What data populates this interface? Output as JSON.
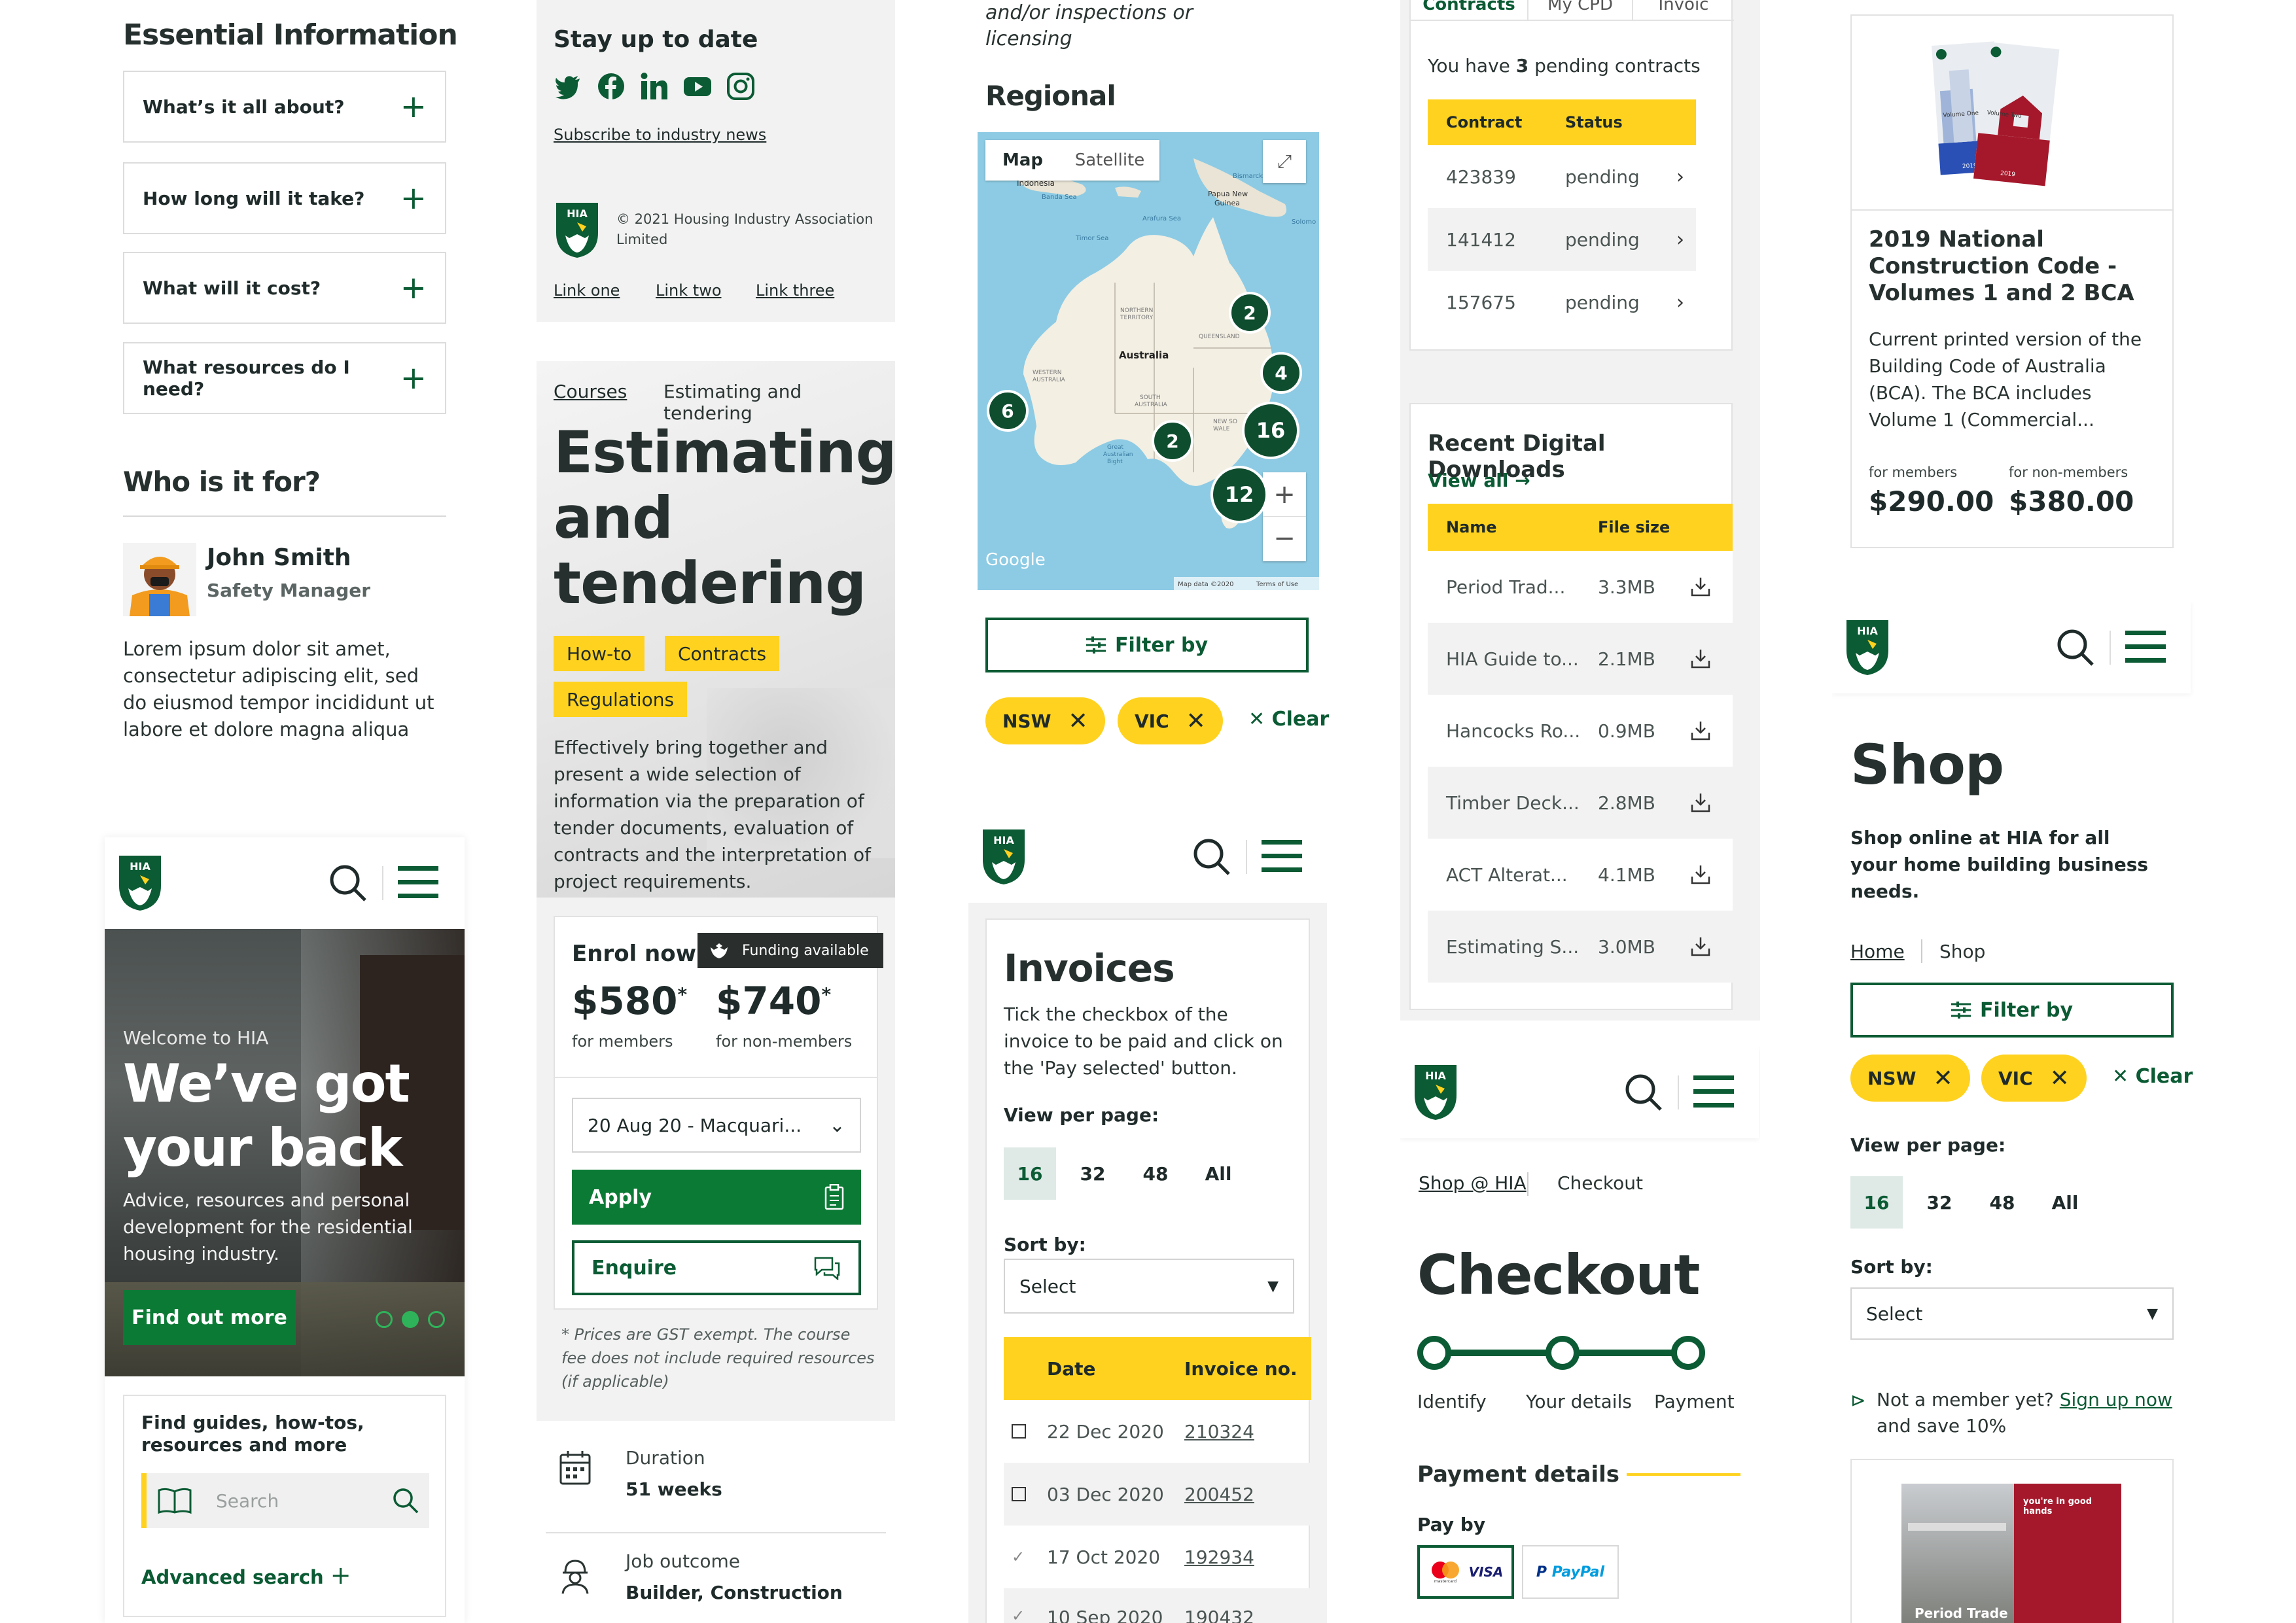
{
  "col1": {
    "essential_title": "Essential Information",
    "accordion": [
      "What’s it all about?",
      "How long will it take?",
      "What will it cost?",
      "What resources do I need?"
    ],
    "who_title": "Who is it for?",
    "person_name": "John Smith",
    "person_role": "Safety Manager",
    "person_text": "Lorem ipsum dolor sit amet, consectetur adipiscing elit, sed do eiusmod tempor incididunt ut labore et dolore magna aliqua",
    "hero_kicker": "Welcome to HIA",
    "hero_title_1": "We’ve got",
    "hero_title_2": "your back",
    "hero_text": "Advice, resources and personal development for the residential housing industry.",
    "hero_button": "Find out more",
    "search_title": "Find guides, how-tos, resources and more",
    "search_placeholder": "Search",
    "advanced_search": "Advanced search"
  },
  "col2": {
    "stay_title": "Stay up to date",
    "subscribe": "Subscribe to industry news",
    "copyright": "© 2021 Housing Industry Association Limited",
    "links": [
      "Link one",
      "Link two",
      "Link three"
    ],
    "crumb_1": "Courses",
    "crumb_2": "Estimating and tendering",
    "title_1": "Estimating",
    "title_2": "and",
    "title_3": "tendering",
    "tags": [
      "How-to",
      "Contracts",
      "Regulations"
    ],
    "description": "Effectively bring together and present a wide selection of information via the preparation of tender documents, evaluation of contracts and the interpretation of project requirements.",
    "enrol": "Enrol now",
    "funding": "Funding available",
    "price_member": "$580",
    "price_nonmember": "$740",
    "asterisk": "*",
    "for_members": "for members",
    "for_nonmembers": "for non-members",
    "date_select": "20 Aug 20 - Macquari...",
    "apply": "Apply",
    "enquire": "Enquire",
    "footnote": "* Prices are GST exempt. The course fee does not include required resources (if applicable)",
    "duration_label": "Duration",
    "duration_value": "51 weeks",
    "job_label": "Job outcome",
    "job_value": "Builder, Construction"
  },
  "col3": {
    "top_text_1": "and/or inspections or",
    "top_text_2": "licensing",
    "regional": "Regional",
    "map_tab_1": "Map",
    "map_tab_2": "Satellite",
    "map_labels": [
      "Indonesia",
      "Papua New Guinea",
      "Australia",
      "NORTHERN TERRITORY",
      "QUEENSLAND",
      "WESTERN AUSTRALIA",
      "SOUTH AUSTRALIA",
      "Great Australian Bight",
      "NEW SOUTH WALES",
      "Google",
      "Map data ©2020",
      "Terms of Use",
      "Timor Sea",
      "Arafura Sea",
      "Banda Sea",
      "Solomo",
      "Bismarck"
    ],
    "clusters": [
      "2",
      "4",
      "6",
      "2",
      "16",
      "12"
    ],
    "filter_by": "Filter by",
    "chips": [
      "NSW",
      "VIC"
    ],
    "clear": "Clear",
    "invoices_title": "Invoices",
    "invoices_text": "Tick the checkbox of the invoice to be paid and click on the 'Pay selected' button.",
    "view_per_page": "View per page:",
    "pages": [
      "16",
      "32",
      "48",
      "All"
    ],
    "sort_by": "Sort by:",
    "select": "Select",
    "col_date": "Date",
    "col_invoice": "Invoice no.",
    "invoice_rows": [
      {
        "date": "22 Dec 2020",
        "no": "210324"
      },
      {
        "date": "03 Dec 2020",
        "no": "200452"
      },
      {
        "date": "17 Oct 2020",
        "no": "192934"
      },
      {
        "date": "10 Sep 2020",
        "no": "190432"
      }
    ]
  },
  "col4": {
    "tabs": [
      "Contracts",
      "My CPD",
      "Invoic"
    ],
    "pending_pre": "You have ",
    "pending_num": "3",
    "pending_post": " pending contracts",
    "col_contract": "Contract",
    "col_status": "Status",
    "contracts": [
      {
        "id": "423839",
        "status": "pending"
      },
      {
        "id": "141412",
        "status": "pending"
      },
      {
        "id": "157675",
        "status": "pending"
      }
    ],
    "downloads_title": "Recent Digital Downloads",
    "view_all": "View all",
    "col_name": "Name",
    "col_size": "File size",
    "downloads": [
      {
        "name": "Period Trad...",
        "size": "3.3MB"
      },
      {
        "name": "HIA Guide to...",
        "size": "2.1MB"
      },
      {
        "name": "Hancocks Ro...",
        "size": "0.9MB"
      },
      {
        "name": "Timber Deck...",
        "size": "2.8MB"
      },
      {
        "name": "ACT Alterat...",
        "size": "4.1MB"
      },
      {
        "name": "Estimating S...",
        "size": "3.0MB"
      }
    ],
    "crumb_1": "Shop @ HIA",
    "crumb_2": "Checkout",
    "checkout_title": "Checkout",
    "steps": [
      "Identify",
      "Your details",
      "Payment"
    ],
    "payment_details": "Payment details",
    "pay_by": "Pay by",
    "visa": "VISA",
    "mastercard": "mastercard",
    "paypal": "PayPal"
  },
  "col5": {
    "book_title": "2019 National Construction Code - Volumes 1 and 2 BCA",
    "book_text": "Current printed version of the Building Code of Australia (BCA). The BCA includes Volume 1 (Commercial...",
    "cover_1": "Volume One",
    "cover_2": "Volume Two",
    "cover_year": "2019",
    "for_members": "for members",
    "for_nonmembers": "for non-members",
    "price_member": "$290.00",
    "price_nonmember": "$380.00",
    "shop_title": "Shop",
    "shop_text": "Shop online at HIA for all your home building business needs.",
    "crumb_1": "Home",
    "crumb_2": "Shop",
    "filter_by": "Filter by",
    "chips": [
      "NSW",
      "VIC"
    ],
    "clear": "Clear",
    "view_per_page": "View per page:",
    "pages": [
      "16",
      "32",
      "48",
      "All"
    ],
    "sort_by": "Sort by:",
    "select": "Select",
    "not_member": "Not a member yet?",
    "sign_up": "Sign up now",
    "save": "and save 10%",
    "product_badge": "you're in good hands",
    "product_label": "Period Trade"
  },
  "brand": {
    "logo_text": "HIA",
    "green": "#0b5b34",
    "yellow": "#ffd21f"
  }
}
